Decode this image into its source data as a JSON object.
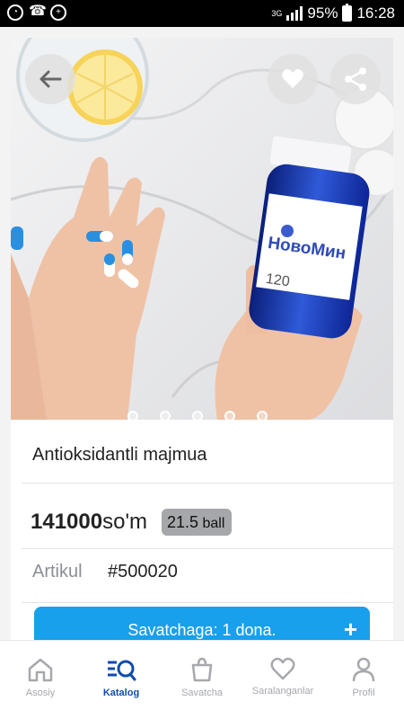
{
  "status_bar": {
    "network": "3G",
    "battery_percent": "95%",
    "time": "16:28",
    "icons": [
      "data-saver-icon",
      "missed-call-icon",
      "add-circle-icon",
      "signal-icon",
      "battery-icon"
    ]
  },
  "product": {
    "name": "Antioksidantli majmua",
    "price": "141000",
    "currency": "so'm",
    "ball_value": "21.5",
    "ball_unit": "ball",
    "artikul_label": "Artikul",
    "artikul_value": "#500020",
    "bottle_brand": "НовоМин",
    "bottle_count": "120"
  },
  "gallery": {
    "slides": 5,
    "active_slide": 1
  },
  "cart_button": {
    "label": "Savatchaga: 1 dona.",
    "plus": "+"
  },
  "tabbar": {
    "items": [
      {
        "label": "Asosiy",
        "icon": "home-icon"
      },
      {
        "label": "Katalog",
        "icon": "catalog-search-icon",
        "active": true
      },
      {
        "label": "Savatcha",
        "icon": "shopping-bag-icon"
      },
      {
        "label": "Saralanganlar",
        "icon": "heart-icon"
      },
      {
        "label": "Profil",
        "icon": "profile-icon"
      }
    ]
  },
  "colors": {
    "accent": "#18a0ec",
    "active_tab": "#0f4bb0",
    "inactive_tab": "#a6a8ad",
    "ball_badge": "#a5a7ab"
  }
}
